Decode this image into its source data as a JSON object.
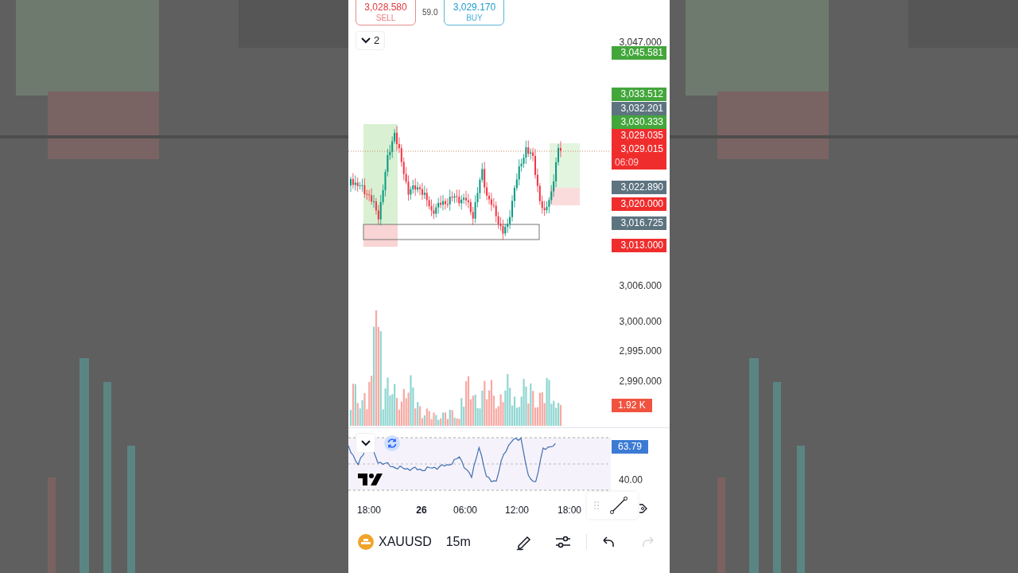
{
  "quote": {
    "sell": {
      "price": "3,028.580",
      "label": "SELL"
    },
    "spread": "59.0",
    "buy": {
      "price": "3,029.170",
      "label": "BUY"
    }
  },
  "legend_toggle": {
    "count": "2"
  },
  "price_axis": {
    "ticks": [
      "3,047.000",
      "3,006.000",
      "3,000.000",
      "2,995.000",
      "2,990.000"
    ]
  },
  "price_labels": [
    {
      "text": "3,045.581",
      "color": "#43a63b"
    },
    {
      "text": "3,033.512",
      "color": "#43a63b"
    },
    {
      "text": "3,032.201",
      "color": "#5d7480"
    },
    {
      "text": "3,030.333",
      "color": "#43a63b"
    },
    {
      "text": "3,029.035",
      "color": "#f02d2d"
    },
    {
      "text": "3,029.015",
      "countdown": "06:09",
      "color": "#f02d2d"
    },
    {
      "text": "3,022.890",
      "color": "#5d7480"
    },
    {
      "text": "3,020.000",
      "color": "#f02d2d"
    },
    {
      "text": "3,016.725",
      "color": "#5d7480"
    },
    {
      "text": "3,013.000",
      "color": "#f02d2d"
    }
  ],
  "volume_label": "1.92 K",
  "rsi": {
    "value": "63.79",
    "tick": "40.00"
  },
  "time_axis": [
    {
      "label": "18:00",
      "bold": false
    },
    {
      "label": "26",
      "bold": true
    },
    {
      "label": "06:00",
      "bold": false
    },
    {
      "label": "12:00",
      "bold": false
    },
    {
      "label": "18:00",
      "bold": false
    }
  ],
  "toolbar": {
    "symbol": "XAUUSD",
    "interval": "15m"
  }
}
